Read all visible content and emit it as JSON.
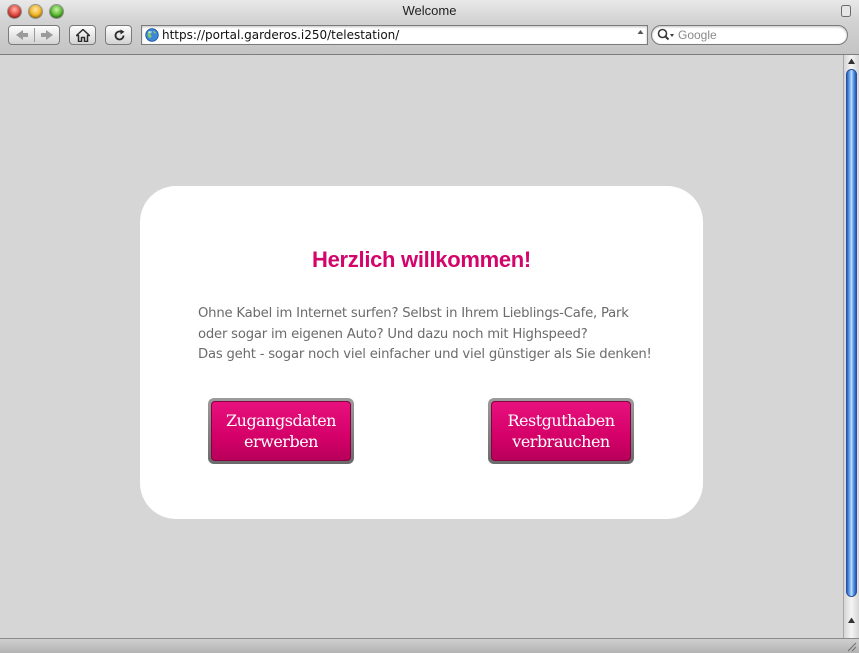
{
  "window": {
    "title": "Welcome"
  },
  "toolbar": {
    "back_icon": "back-arrow-icon",
    "forward_icon": "forward-arrow-icon",
    "home_icon": "home-icon",
    "reload_icon": "reload-icon"
  },
  "address_bar": {
    "url": "https://portal.garderos.i250/telestation/"
  },
  "search": {
    "placeholder": "Google"
  },
  "page": {
    "heading": "Herzlich willkommen!",
    "intro_lines": [
      "Ohne Kabel im Internet surfen? Selbst in Ihrem Lieblings-Cafe, Park",
      "oder sogar im eigenen Auto? Und dazu noch mit Highspeed?",
      "Das geht - sogar noch viel einfacher und viel günstiger als Sie denken!"
    ],
    "buttons": {
      "buy_access": [
        "Zugangsdaten",
        "erwerben"
      ],
      "use_credit": [
        "Restguthaben",
        "verbrauchen"
      ]
    }
  },
  "colors": {
    "brand_magenta": "#d3056b",
    "body_text": "#6b6b6b",
    "page_background": "#d6d6d6",
    "card_background": "#ffffff"
  }
}
